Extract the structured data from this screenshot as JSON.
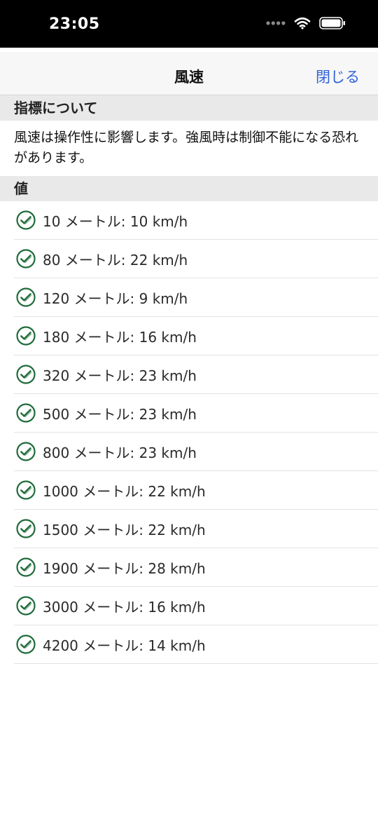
{
  "status_bar": {
    "time": "23:05",
    "icons": [
      "signal-dots-icon",
      "wifi-icon",
      "battery-icon"
    ]
  },
  "nav": {
    "title": "風速",
    "close_label": "閉じる"
  },
  "about_section": {
    "header": "指標について",
    "description": "風速は操作性に影響します。強風時は制御不能になる恐れがあります。"
  },
  "values_section": {
    "header": "値",
    "items": [
      {
        "label": "10 メートル: 10 km/h",
        "icon": "check-circle-icon"
      },
      {
        "label": "80 メートル: 22 km/h",
        "icon": "check-circle-icon"
      },
      {
        "label": "120 メートル: 9 km/h",
        "icon": "check-circle-icon"
      },
      {
        "label": "180 メートル: 16 km/h",
        "icon": "check-circle-icon"
      },
      {
        "label": "320 メートル: 23 km/h",
        "icon": "check-circle-icon"
      },
      {
        "label": "500 メートル: 23 km/h",
        "icon": "check-circle-icon"
      },
      {
        "label": "800 メートル: 23 km/h",
        "icon": "check-circle-icon"
      },
      {
        "label": "1000 メートル: 22 km/h",
        "icon": "check-circle-icon"
      },
      {
        "label": "1500 メートル: 22 km/h",
        "icon": "check-circle-icon"
      },
      {
        "label": "1900 メートル: 28 km/h",
        "icon": "check-circle-icon"
      },
      {
        "label": "3000 メートル: 16 km/h",
        "icon": "check-circle-icon"
      },
      {
        "label": "4200 メートル: 14 km/h",
        "icon": "check-circle-icon"
      }
    ]
  },
  "colors": {
    "accent": "#2f63d8",
    "check": "#1f6b3a",
    "section_bg": "#e9e9e9",
    "nav_bg": "#f7f7f7"
  }
}
